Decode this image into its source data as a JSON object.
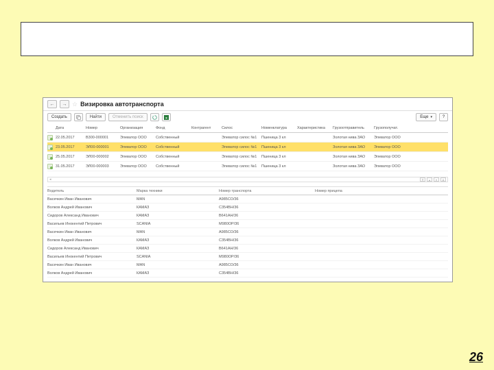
{
  "slide": {
    "page_number": "26"
  },
  "window": {
    "title": "Визировка автотранспорта",
    "nav_back": "←",
    "nav_fwd": "→",
    "toolbar": {
      "create": "Создать",
      "find": "Найти",
      "cancel_search": "Отменить поиск",
      "more": "Еще",
      "help": "?"
    },
    "columns": {
      "date": "Дата",
      "number": "Номер",
      "org": "Организация",
      "fund": "Фонд",
      "counterparty": "Контрагент",
      "silo": "Силос",
      "nomen": "Номенклатура",
      "char": "Характеристика",
      "shipper": "Грузоотправитель",
      "consignee": "Грузополучат."
    },
    "rows": [
      {
        "date": "22.05.2017",
        "number": "В300-000001",
        "org": "Элеватор ООО",
        "fund": "Собственный",
        "cp": "",
        "silo": "Элеватор силос №1",
        "nom": "Пшеница 3 кл",
        "char": "",
        "ship": "Золотая нива ЗАО",
        "cons": "Элеватор ООО"
      },
      {
        "date": "23.05.2017",
        "number": "ЭЛ00-000001",
        "org": "Элеватор ООО",
        "fund": "Собственный",
        "cp": "",
        "silo": "Элеватор силос №1",
        "nom": "Пшеница 3 кл",
        "char": "",
        "ship": "Золотая нива ЗАО",
        "cons": "Элеватор ООО",
        "sel": true
      },
      {
        "date": "25.05.2017",
        "number": "ЭЛ00-000002",
        "org": "Элеватор ООО",
        "fund": "Собственный",
        "cp": "",
        "silo": "Элеватор силос №1",
        "nom": "Пшеница 3 кл",
        "char": "",
        "ship": "Золотая нива ЗАО",
        "cons": "Элеватор ООО"
      },
      {
        "date": "31.05.2017",
        "number": "ЭЛ00-000003",
        "org": "Элеватор ООО",
        "fund": "Собственный",
        "cp": "",
        "silo": "Элеватор силос №1",
        "nom": "Пшеница 3 кл",
        "char": "",
        "ship": "Золотая нива ЗАО",
        "cons": "Элеватор ООО"
      }
    ],
    "lower_columns": {
      "driver": "Водитель",
      "vehicle": "Марка техники",
      "plate": "Номер транспорта",
      "trailer": "Номер прицепа"
    },
    "lower_rows": [
      {
        "driver": "Васечкин Иван Иванович",
        "vehicle": "MAN",
        "plate": "А985СО/36"
      },
      {
        "driver": "Волков Андрей Иванович",
        "vehicle": "КАМАЗ",
        "plate": "С354ВН/36"
      },
      {
        "driver": "Сидоров Александ Иванович",
        "vehicle": "КАМАЗ",
        "plate": "В641АН/36"
      },
      {
        "driver": "Васильев Инокентий Петрович",
        "vehicle": "SCANIA",
        "plate": "М980ОР/36"
      },
      {
        "driver": "Васечкин Иван Иванович",
        "vehicle": "MAN",
        "plate": "А985СО/36"
      },
      {
        "driver": "Волков Андрей Иванович",
        "vehicle": "КАМАЗ",
        "plate": "С354ВН/36"
      },
      {
        "driver": "Сидоров Александ Иванович",
        "vehicle": "КАМАЗ",
        "plate": "В641АН/36"
      },
      {
        "driver": "Васильев Инокентий Петрович",
        "vehicle": "SCANIA",
        "plate": "М980ОР/36"
      },
      {
        "driver": "Васечкин Иван Иванович",
        "vehicle": "MAN",
        "plate": "А985СО/36"
      },
      {
        "driver": "Волков Андрей Иванович",
        "vehicle": "КАМАЗ",
        "plate": "С354ВН/36"
      }
    ]
  }
}
